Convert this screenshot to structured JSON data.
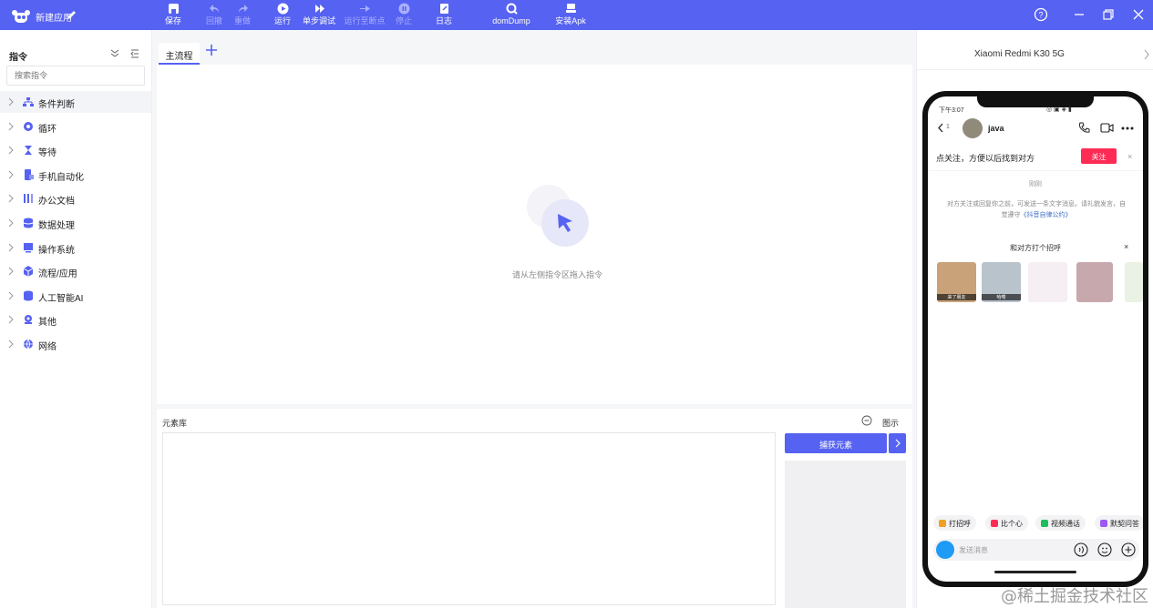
{
  "app": {
    "title": "新建应用",
    "logo_icon": "robot-logo-icon",
    "edit_icon": "pencil-icon"
  },
  "toolbar": {
    "buttons": [
      {
        "label": "保存",
        "icon": "save-icon",
        "enabled": true
      },
      {
        "label": "回撤",
        "icon": "undo-icon",
        "enabled": false
      },
      {
        "label": "重做",
        "icon": "redo-icon",
        "enabled": false
      },
      {
        "label": "运行",
        "icon": "play-icon",
        "enabled": true
      },
      {
        "label": "单步调试",
        "icon": "step-icon",
        "enabled": true
      },
      {
        "label": "运行至断点",
        "icon": "breakpoint-icon",
        "enabled": false
      },
      {
        "label": "停止",
        "icon": "stop-icon",
        "enabled": false
      },
      {
        "label": "日志",
        "icon": "log-icon",
        "enabled": true
      },
      {
        "label": "domDump",
        "icon": "dom-dump-icon",
        "enabled": true
      },
      {
        "label": "安装Apk",
        "icon": "install-apk-icon",
        "enabled": true
      }
    ],
    "accent_color": "#5662f1"
  },
  "sidebar": {
    "title": "指令",
    "search_placeholder": "搜索指令",
    "categories": [
      {
        "label": "条件判断",
        "icon": "condition-icon"
      },
      {
        "label": "循环",
        "icon": "loop-icon"
      },
      {
        "label": "等待",
        "icon": "hourglass-icon"
      },
      {
        "label": "手机自动化",
        "icon": "phone-automation-icon"
      },
      {
        "label": "办公文档",
        "icon": "office-doc-icon"
      },
      {
        "label": "数据处理",
        "icon": "database-icon"
      },
      {
        "label": "操作系统",
        "icon": "os-icon"
      },
      {
        "label": "流程/应用",
        "icon": "cube-icon"
      },
      {
        "label": "人工智能AI",
        "icon": "ai-icon"
      },
      {
        "label": "其他",
        "icon": "other-icon"
      },
      {
        "label": "网络",
        "icon": "globe-icon"
      }
    ]
  },
  "editor": {
    "tabs": [
      {
        "label": "主流程"
      }
    ],
    "empty_text": "请从左侧指令区拖入指令"
  },
  "element_library": {
    "title": "元素库",
    "toggle_label": "图示",
    "capture_label": "捕获元素"
  },
  "device": {
    "name": "Xiaomi Redmi K30 5G",
    "status_time": "下午3:07",
    "chat": {
      "unread_count": "1",
      "contact_name": "java",
      "follow_prompt": "点关注，方便以后找到对方",
      "follow_button": "关注",
      "close_glyph": "×",
      "time_label": "刚刚",
      "notice": "对方关注或回复你之前，可发送一条文字消息。请礼貌发言，自觉遵守",
      "notice_link": "《抖音自律公约》",
      "greet_title": "和对方打个招呼",
      "stickers": [
        {
          "caption": "来了朋友",
          "color": "#c9a27a"
        },
        {
          "caption": "哈喽",
          "color": "#b9c3cc"
        },
        {
          "caption": "",
          "color": "#f5eef2"
        },
        {
          "caption": "",
          "color": "#c7a8ad"
        },
        {
          "caption": "",
          "color": "#e9f2e4"
        }
      ],
      "quick_actions": [
        {
          "label": "打招呼",
          "color": "#f0a020"
        },
        {
          "label": "比个心",
          "color": "#fe2c55"
        },
        {
          "label": "视频通话",
          "color": "#1bbf5b"
        },
        {
          "label": "默契问答",
          "color": "#9b59f5"
        }
      ],
      "input_placeholder": "发送消息"
    }
  },
  "watermark": "@稀土掘金技术社区"
}
